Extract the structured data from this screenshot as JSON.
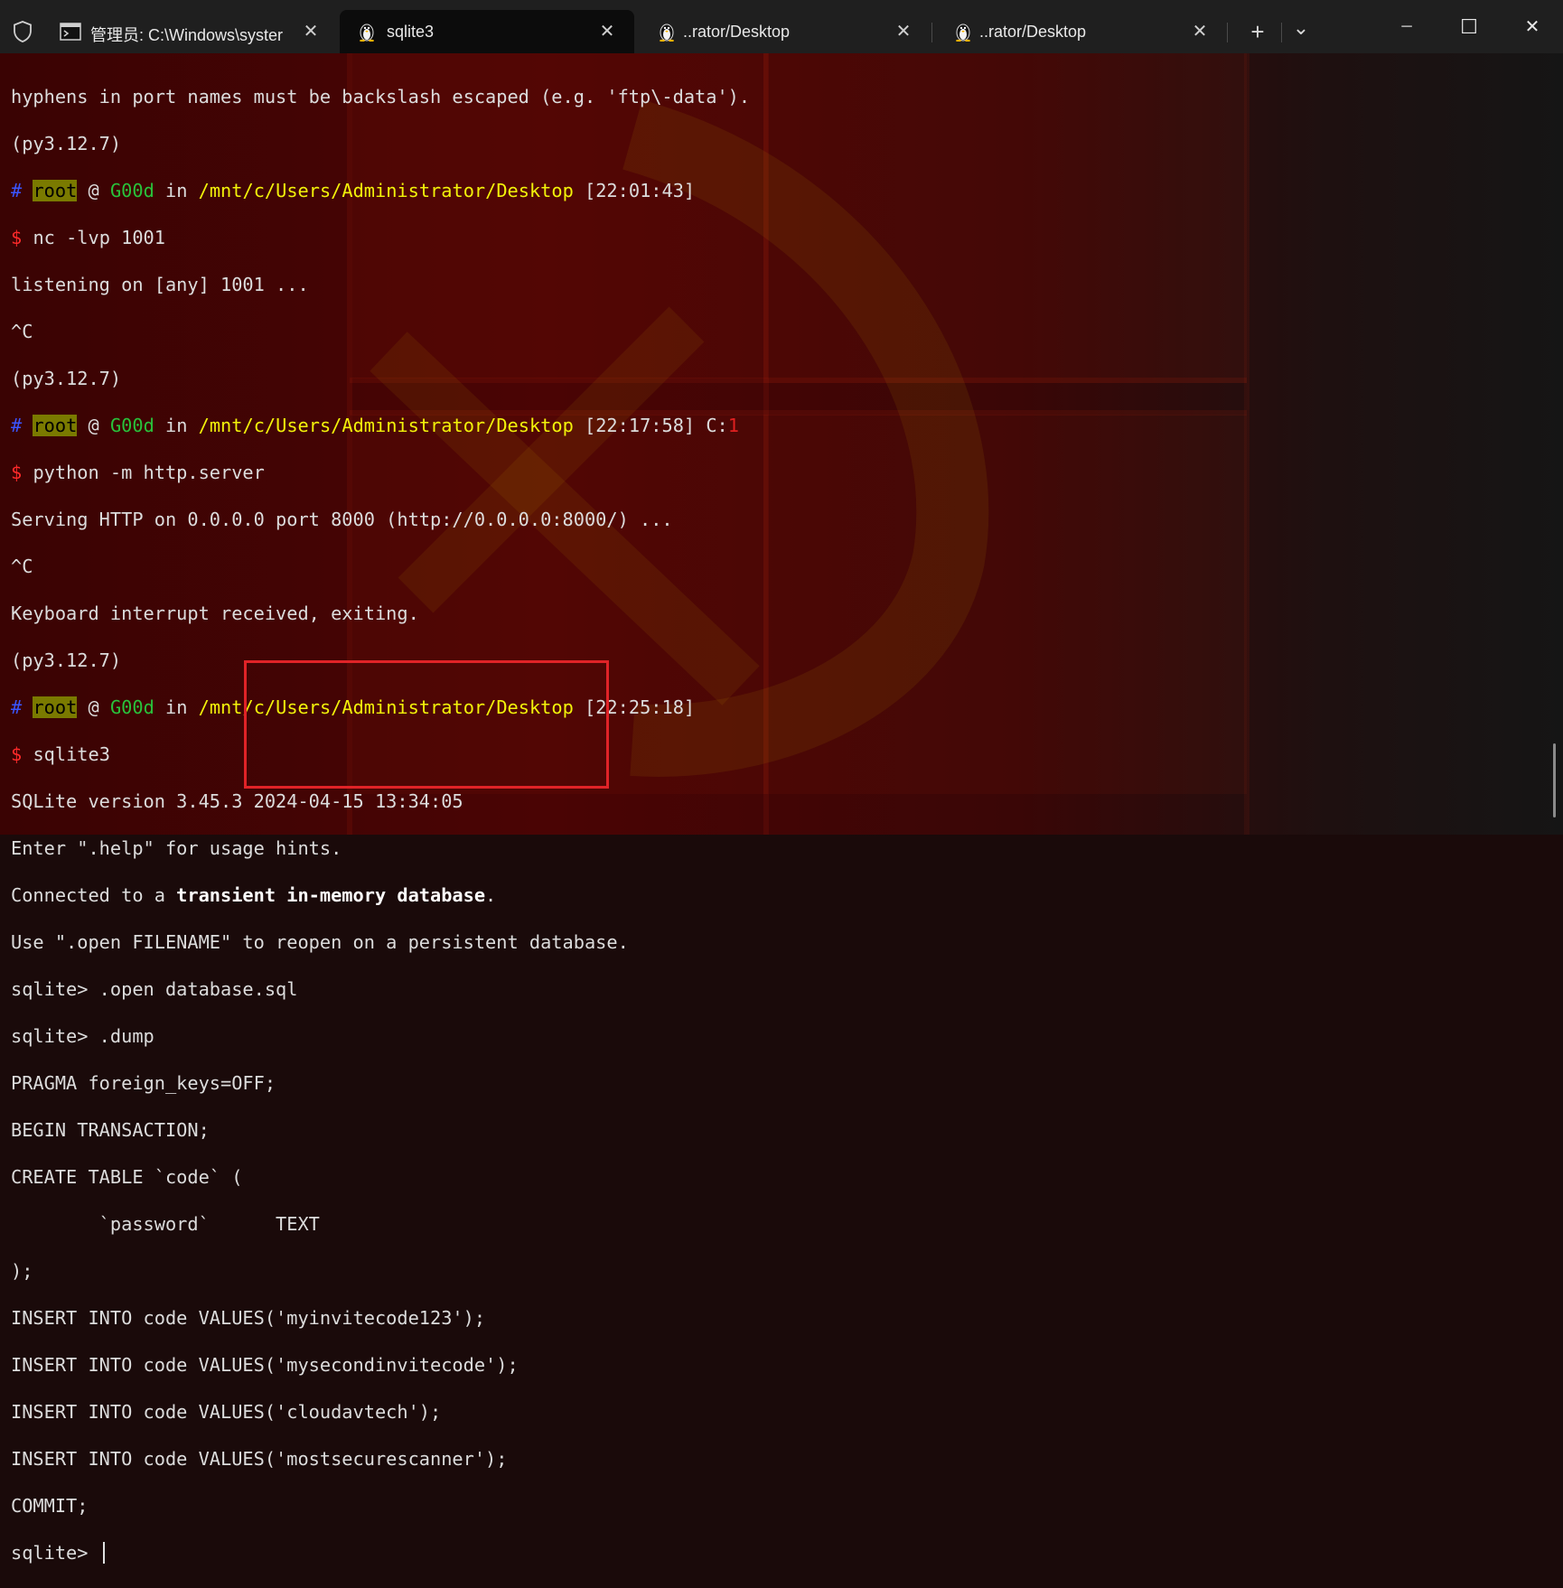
{
  "window": {
    "tabs": [
      {
        "label": "管理员: C:\\Windows\\syster",
        "icon": "cmd-icon",
        "active": false
      },
      {
        "label": "sqlite3",
        "icon": "linux-penguin-icon",
        "active": true
      },
      {
        "label": "..rator/Desktop",
        "icon": "linux-penguin-icon",
        "active": false
      },
      {
        "label": "..rator/Desktop",
        "icon": "linux-penguin-icon",
        "active": false
      }
    ],
    "close_glyph": "✕",
    "new_tab_glyph": "+",
    "dropdown_glyph": "⌄",
    "minimize_glyph": "─",
    "maximize_glyph": "☐",
    "window_close_glyph": "✕"
  },
  "prompt": {
    "hash": "#",
    "user": "root",
    "at": "@",
    "host": "G00d",
    "in": "in",
    "path": "/mnt/c/Users/Administrator/Desktop",
    "dollar": "$"
  },
  "terminal": {
    "l01": "hyphens in port names must be backslash escaped (e.g. 'ftp\\-data').",
    "l02": "(py3.12.7)",
    "p1_time": "[22:01:43]",
    "c1": "nc -lvp 1001",
    "l05": "listening on [any] 1001 ...",
    "l06": "^C",
    "l07": "(py3.12.7)",
    "p2_time": "[22:17:58]",
    "p2_code_label": "C:",
    "p2_code": "1",
    "c2": "python -m http.server",
    "l10": "Serving HTTP on 0.0.0.0 port 8000 (http://0.0.0.0:8000/) ...",
    "l11": "^C",
    "l12": "Keyboard interrupt received, exiting.",
    "l13": "(py3.12.7)",
    "p3_time": "[22:25:18]",
    "c3": "sqlite3",
    "l16": "SQLite version 3.45.3 2024-04-15 13:34:05",
    "l17": "Enter \".help\" for usage hints.",
    "l18_pre": "Connected to a ",
    "l18_bold": "transient in-memory database",
    "l18_post": ".",
    "l19": "Use \".open FILENAME\" to reopen on a persistent database.",
    "l20": "sqlite> .open database.sql",
    "l21": "sqlite> .dump",
    "l22": "PRAGMA foreign_keys=OFF;",
    "l23": "BEGIN TRANSACTION;",
    "l24": "CREATE TABLE `code` (",
    "l25": "        `password`      TEXT",
    "l26": ");",
    "l27": "INSERT INTO code VALUES('myinvitecode123');",
    "l28": "INSERT INTO code VALUES('mysecondinvitecode');",
    "l29": "INSERT INTO code VALUES('cloudavtech');",
    "l30": "INSERT INTO code VALUES('mostsecurescanner');",
    "l31": "COMMIT;",
    "l32": "sqlite> "
  },
  "colors": {
    "highlight_box": "#e02327",
    "prompt_path": "#f2f20a",
    "prompt_host": "#29c23b",
    "prompt_hash": "#3a55ff",
    "prompt_dollar": "#ff2a2a"
  }
}
